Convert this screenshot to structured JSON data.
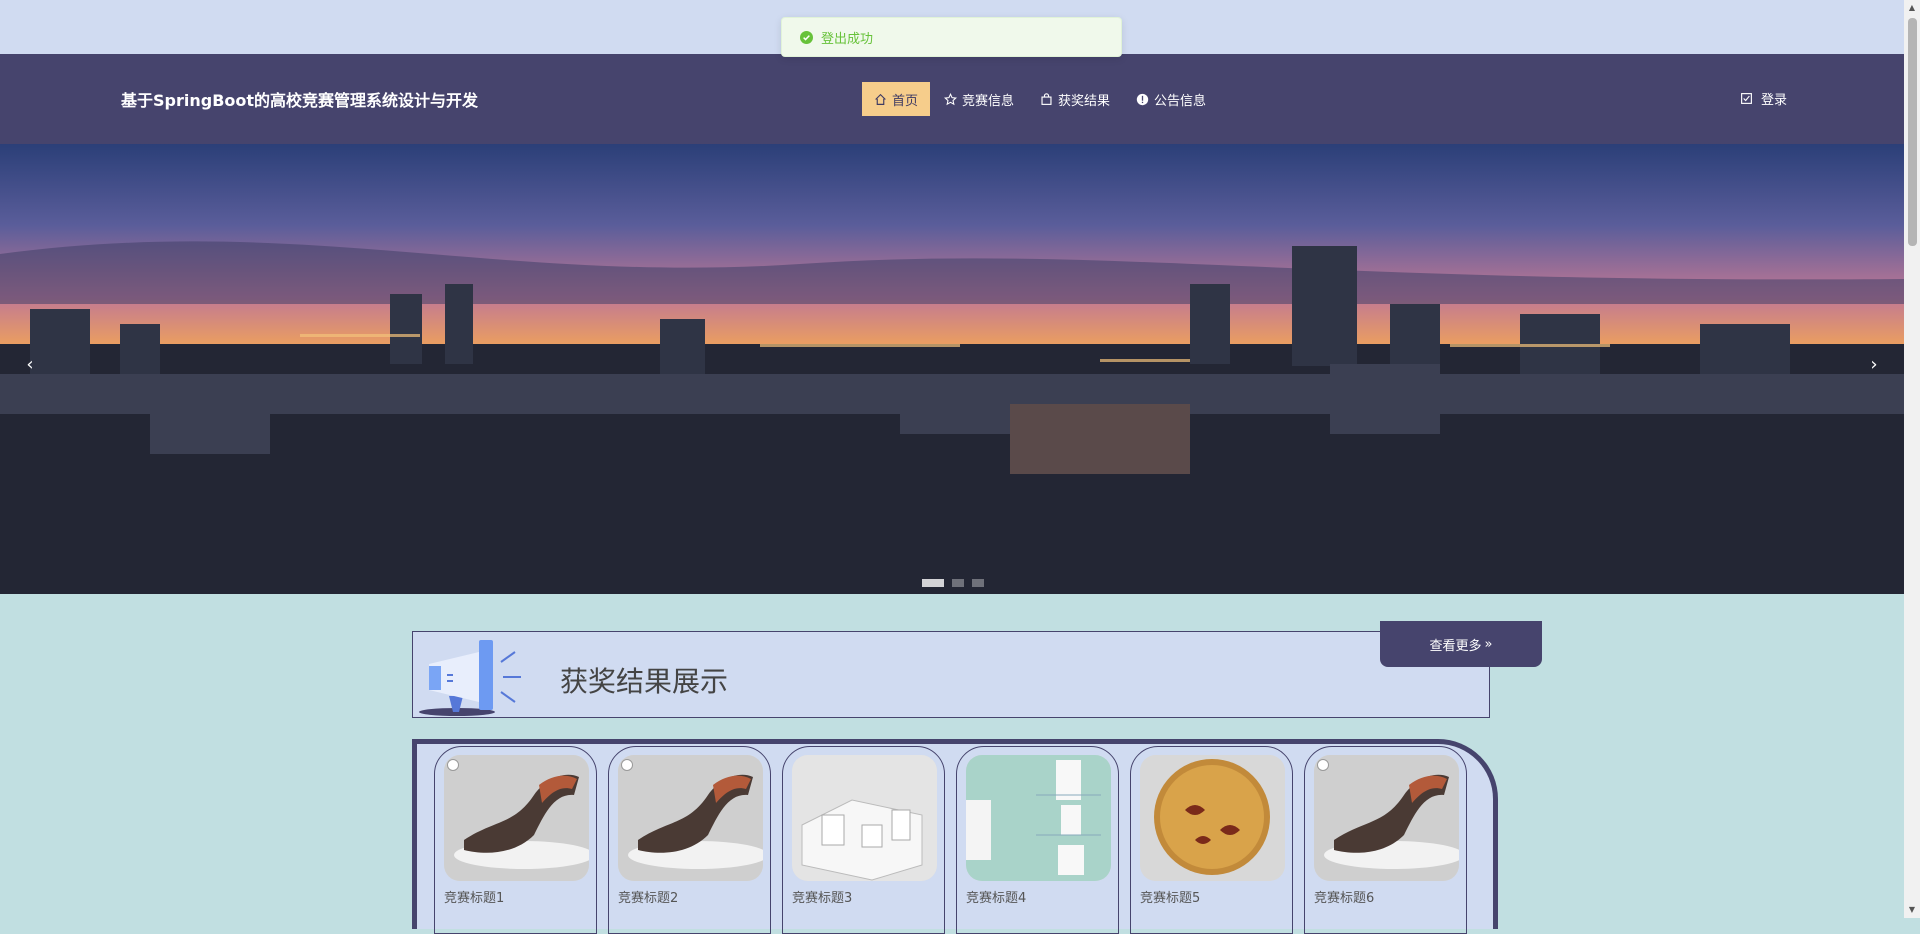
{
  "toast": {
    "message": "登出成功",
    "icon": "check-circle-icon",
    "color": "#67c23a"
  },
  "header": {
    "brand": "基于SpringBoot的高校竞赛管理系统设计与开发",
    "nav": [
      {
        "label": "首页",
        "icon": "home-icon",
        "active": true
      },
      {
        "label": "竞赛信息",
        "icon": "star-icon"
      },
      {
        "label": "获奖结果",
        "icon": "bag-icon"
      },
      {
        "label": "公告信息",
        "icon": "info-icon"
      }
    ],
    "login_label": "登录"
  },
  "banner": {
    "prev": "‹",
    "next": "›",
    "slides": 3,
    "active_slide": 1
  },
  "section": {
    "title": "获奖结果展示",
    "more_label": "查看更多",
    "more_icon": "»",
    "items": [
      {
        "title": "竞赛标题1",
        "image": "lounge-chair"
      },
      {
        "title": "竞赛标题2",
        "image": "lounge-chair"
      },
      {
        "title": "竞赛标题3",
        "image": "architecture-model"
      },
      {
        "title": "竞赛标题4",
        "image": "bathroom-fixtures"
      },
      {
        "title": "竞赛标题5",
        "image": "bamboo-plate"
      },
      {
        "title": "竞赛标题6",
        "image": "lounge-chair"
      }
    ]
  },
  "colors": {
    "header": "#46446d",
    "accent": "#f6cd8b",
    "page": "#c1dfe1",
    "panel": "#d0dbf1"
  }
}
